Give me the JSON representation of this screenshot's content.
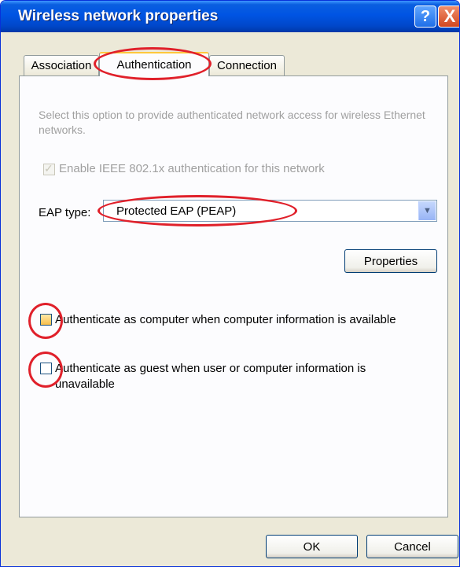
{
  "window": {
    "title": "Wireless network properties",
    "help_glyph": "?",
    "close_glyph": "X"
  },
  "tabs": [
    {
      "label": "Association",
      "selected": false
    },
    {
      "label": "Authentication",
      "selected": true
    },
    {
      "label": "Connection",
      "selected": false
    }
  ],
  "authentication": {
    "description": "Select this option to provide authenticated network access for wireless Ethernet networks.",
    "enable_8021x": {
      "label": "Enable IEEE 802.1x authentication for this network",
      "checked": true,
      "disabled": true
    },
    "eap_type_label": "EAP type:",
    "eap_type_value": "Protected EAP (PEAP)",
    "properties_button": "Properties",
    "auth_as_computer": {
      "label": "Authenticate as computer when computer information is available",
      "checked": false
    },
    "auth_as_guest": {
      "label": "Authenticate as guest when user or computer information is unavailable",
      "checked": false
    }
  },
  "footer": {
    "ok_button": "OK",
    "cancel_button": "Cancel"
  },
  "colors": {
    "annotation": "#e0202a",
    "titlebar": "#0054e3",
    "dialog_bg": "#ece9d8"
  }
}
